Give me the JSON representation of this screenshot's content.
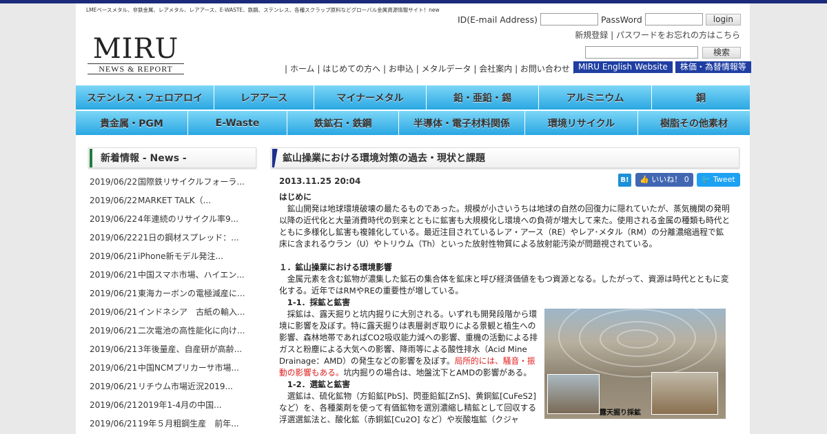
{
  "site": {
    "tagline": "LMEベースメタル、非鉄金属、レアメタル、レアアース、E-WASTE、鉄鋼、ステンレス、各種スクラップ原料などグローバル金属資源情報サイト！new",
    "logo_main": "MIRU",
    "logo_sub": "NEWS & REPORT"
  },
  "login": {
    "id_label": "ID(E-mail Address)",
    "pw_label": "PassWord",
    "button": "login",
    "register": "新規登録",
    "separator": " | ",
    "forgot": "パスワードをお忘れの方はこちら"
  },
  "search": {
    "button": "検索"
  },
  "nav": {
    "links": [
      "ホーム",
      "はじめての方へ",
      "お申込",
      "メタルデータ",
      "会社案内",
      "お問い合わせ"
    ],
    "english": "MIRU English Website",
    "stock": "株価・為替情報等"
  },
  "menu_row1": [
    "ステンレス・フェロアロイ",
    "レアアース",
    "マイナーメタル",
    "鉛・亜鉛・錫",
    "アルミニウム",
    "銅"
  ],
  "menu_row2": [
    "貴金属・PGM",
    "E-Waste",
    "鉄鉱石・鉄鋼",
    "半導体・電子材料関係",
    "環境リサイクル",
    "樹脂その他素材"
  ],
  "sidebar": {
    "title": "新着情報 - News -",
    "news": [
      {
        "date": "2019/06/22",
        "title": "国際鉄リサイクルフォーラ..."
      },
      {
        "date": "2019/06/22",
        "title": "MARKET TALK（..."
      },
      {
        "date": "2019/06/22",
        "title": "4年連続のリサイクル率9..."
      },
      {
        "date": "2019/06/22",
        "title": "21日の鋼材スプレッド：..."
      },
      {
        "date": "2019/06/21",
        "title": "iPhone新モデル発注..."
      },
      {
        "date": "2019/06/21",
        "title": "中国スマホ市場、ハイエン..."
      },
      {
        "date": "2019/06/21",
        "title": "東海カーボンの電極減産に..."
      },
      {
        "date": "2019/06/21",
        "title": "インドネシア　古紙の輸入..."
      },
      {
        "date": "2019/06/21",
        "title": "二次電池の高性能化に向け..."
      },
      {
        "date": "2019/06/21",
        "title": "3年後量産、自産研が高齢..."
      },
      {
        "date": "2019/06/21",
        "title": "中国NCMプリカーサ市場..."
      },
      {
        "date": "2019/06/21",
        "title": "リチウム市場近況2019..."
      },
      {
        "date": "2019/06/21",
        "title": "2019年1-4月の中国..."
      },
      {
        "date": "2019/06/21",
        "title": "19年５月粗鋼生産　前年..."
      }
    ]
  },
  "article": {
    "title": "鉱山操業における環境対策の過去・現状と課題",
    "date": "2013.11.25 20:04",
    "share": {
      "hatena": "B!",
      "like": "いいね！ 0",
      "tweet": "Tweet"
    },
    "intro_head": "はじめに",
    "intro": "　鉱山開発は地球環境破壊の最たるものであった。規模が小さいうちは地球の自然の回復力に隠れていたが、蒸気機関の発明以降の近代化と大量消費時代の到来とともに鉱害も大規模化し環境への負荷が増大して来た。使用される金属の種類も時代とともに多様化し鉱害も複雑化している。最近注目されているレア・アース（RE）やレア･メタル（RM）の分離濃縮過程で鉱床に含まれるウラン（U）やトリウム（Th）といった放射性物質による放射能汚染が問題視されている。",
    "s1_head": "１．鉱山操業における環境影響",
    "s1": "　金属元素を含む鉱物が濃集した鉱石の集合体を鉱床と呼び経済価値をもつ資源となる。したがって、資源は時代とともに変化する。近年ではRMやREの重要性が増している。",
    "s11_head": "　1-1．採鉱と鉱害",
    "s11_a": "　採鉱は、露天掘りと坑内掘りに大別される。いずれも開発段階から環境に影響を及ぼす。特に露天掘りは表層剥ぎ取りによる景観と植生への影響、森林地帯であればCO2吸収能力減への影響、重機の活動による排ガスと粉塵による大気への影響、降雨等による酸性排水（Acid Mine Drainage：AMD）の発生などの影響を及ぼす。",
    "s11_red": "局所的には、騒音・振動の影響もある。",
    "s11_b": "坑内掘りの場合は、地盤沈下とAMDの影響がある。",
    "s12_head": "　1-2．選鉱と鉱害",
    "s12": "　選鉱は、硫化鉱物（方鉛鉱[PbS]、閃亜鉛鉱[ZnS]、黄銅鉱[CuFeS2]など）を、各種薬剤を使って有価鉱物を選別濃縮し精鉱として回収する浮選選鉱法と、酸化鉱（赤銅鉱[Cu2O] など）や炭酸塩鉱（クジャ",
    "photo_caption": "露天掘り採鉱"
  }
}
